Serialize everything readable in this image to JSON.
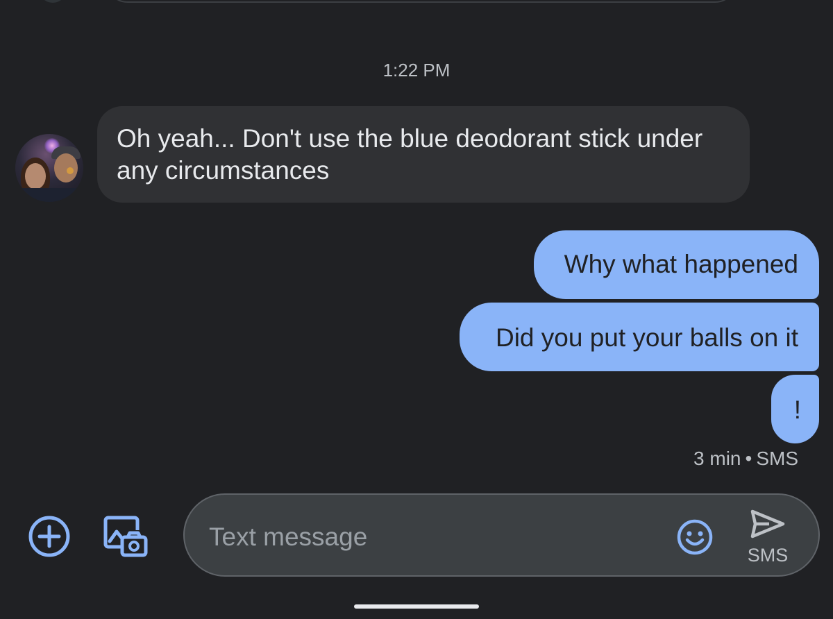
{
  "conversation": {
    "timestamp": "1:22 PM",
    "messages": [
      {
        "direction": "incoming",
        "text": "Oh yeah... Don't use the blue deodorant stick under any circumstances"
      },
      {
        "direction": "outgoing",
        "text": "Why what happened"
      },
      {
        "direction": "outgoing",
        "text": "Did you put your balls on it"
      },
      {
        "direction": "outgoing",
        "text": "!"
      }
    ],
    "status": {
      "age": "3 min",
      "separator": "•",
      "channel": "SMS"
    }
  },
  "composer": {
    "placeholder": "Text message",
    "send_label": "SMS"
  },
  "icons": {
    "add": "add-circle-icon",
    "gallery": "gallery-camera-icon",
    "emoji": "emoji-icon",
    "send": "send-icon"
  },
  "colors": {
    "background": "#202124",
    "incoming_bubble": "#303134",
    "outgoing_bubble": "#8ab4f8",
    "accent": "#8ab4f8",
    "composer": "#3c4043"
  }
}
